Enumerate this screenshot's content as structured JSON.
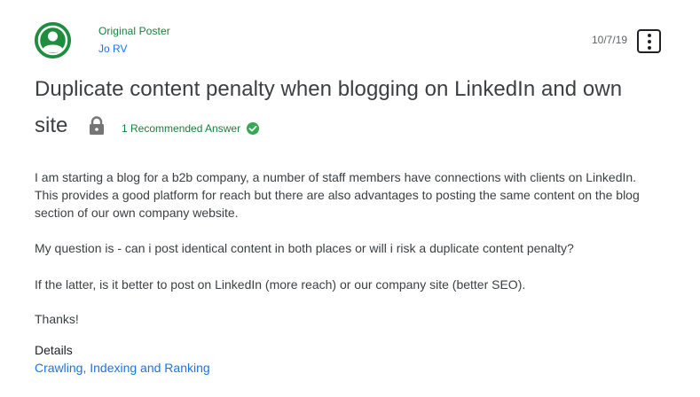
{
  "poster": {
    "role": "Original Poster",
    "name": "Jo RV"
  },
  "post": {
    "date": "10/7/19",
    "title_line1": "Duplicate content penalty when blogging on LinkedIn and own",
    "title_line2": "site",
    "recommended_label": "1 Recommended Answer",
    "body": [
      "I am starting a blog for a b2b company, a number of staff members have connections with clients on LinkedIn. This provides a good platform for reach but there are also advantages to posting the same content on the blog section of our own company website.",
      "My question is - can i post identical content in both places or will i risk a duplicate content penalty?",
      "If the latter, is it better to post on LinkedIn (more reach) or our company site (better SEO).",
      "Thanks!"
    ]
  },
  "details": {
    "label": "Details",
    "link": "Crawling, Indexing and Ranking"
  },
  "icons": {
    "avatar": "person-avatar-icon",
    "more": "more-vert-icon",
    "lock": "lock-icon",
    "check": "check-circle-icon"
  },
  "colors": {
    "green": "#188038",
    "avatar_green": "#1e8e3e",
    "link_blue": "#1a73e8",
    "text": "#3c4043"
  }
}
